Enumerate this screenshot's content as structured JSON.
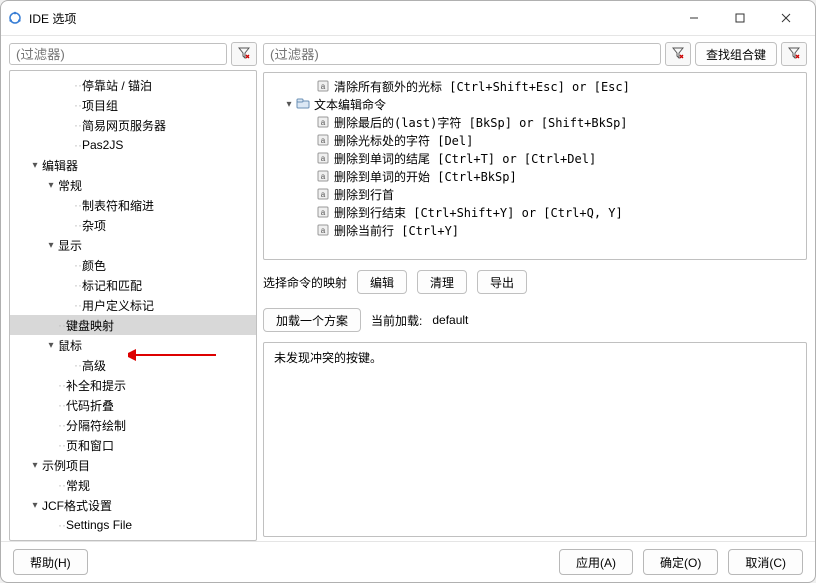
{
  "window": {
    "title": "IDE 选项"
  },
  "filters": {
    "left_placeholder": "(过滤器)",
    "right_placeholder": "(过滤器)",
    "find_combo": "查找组合键"
  },
  "left_tree": [
    {
      "lvl": 2,
      "label": "停靠站 / 锚泊"
    },
    {
      "lvl": 2,
      "label": "项目组"
    },
    {
      "lvl": 2,
      "label": "简易网页服务器"
    },
    {
      "lvl": 2,
      "label": "Pas2JS"
    },
    {
      "lvl": 0,
      "label": "编辑器",
      "twisty": "v"
    },
    {
      "lvl": 1,
      "label": "常规",
      "twisty": "v"
    },
    {
      "lvl": 2,
      "label": "制表符和缩进"
    },
    {
      "lvl": 2,
      "label": "杂项"
    },
    {
      "lvl": 1,
      "label": "显示",
      "twisty": "v"
    },
    {
      "lvl": 2,
      "label": "颜色"
    },
    {
      "lvl": 2,
      "label": "标记和匹配"
    },
    {
      "lvl": 2,
      "label": "用户定义标记"
    },
    {
      "lvl": 1,
      "label": "键盘映射",
      "selected": true
    },
    {
      "lvl": 1,
      "label": "鼠标",
      "twisty": "v"
    },
    {
      "lvl": 2,
      "label": "高级"
    },
    {
      "lvl": 1,
      "label": "补全和提示"
    },
    {
      "lvl": 1,
      "label": "代码折叠"
    },
    {
      "lvl": 1,
      "label": "分隔符绘制"
    },
    {
      "lvl": 1,
      "label": "页和窗口"
    },
    {
      "lvl": 0,
      "label": "示例项目",
      "twisty": "v"
    },
    {
      "lvl": 1,
      "label": "常规"
    },
    {
      "lvl": 0,
      "label": "JCF格式设置",
      "twisty": "v"
    },
    {
      "lvl": 1,
      "label": "Settings File"
    }
  ],
  "cmd_tree": [
    {
      "lvl": 2,
      "icon": "a",
      "label": "清除所有额外的光标  [Ctrl+Shift+Esc]  or  [Esc]"
    },
    {
      "lvl": 1,
      "twisty": "v",
      "icon": "grp",
      "label": "文本编辑命令"
    },
    {
      "lvl": 2,
      "icon": "a",
      "label": "删除最后的(last)字符  [BkSp]  or  [Shift+BkSp]"
    },
    {
      "lvl": 2,
      "icon": "a",
      "label": "删除光标处的字符  [Del]"
    },
    {
      "lvl": 2,
      "icon": "a",
      "label": "删除到单词的结尾  [Ctrl+T]  or  [Ctrl+Del]"
    },
    {
      "lvl": 2,
      "icon": "a",
      "label": "删除到单词的开始  [Ctrl+BkSp]"
    },
    {
      "lvl": 2,
      "icon": "a",
      "label": "删除到行首"
    },
    {
      "lvl": 2,
      "icon": "a",
      "label": "删除到行结束  [Ctrl+Shift+Y]  or  [Ctrl+Q, Y]"
    },
    {
      "lvl": 2,
      "icon": "a",
      "label": "删除当前行  [Ctrl+Y]"
    }
  ],
  "buttons": {
    "map_label": "选择命令的映射",
    "edit": "编辑",
    "clear": "清理",
    "export": "导出",
    "load_scheme": "加载一个方案",
    "current_load_lbl": "当前加载:",
    "current_load_val": "default"
  },
  "conflict": {
    "text": "未发现冲突的按键。"
  },
  "footer": {
    "help": "帮助(H)",
    "apply": "应用(A)",
    "ok": "确定(O)",
    "cancel": "取消(C)"
  }
}
